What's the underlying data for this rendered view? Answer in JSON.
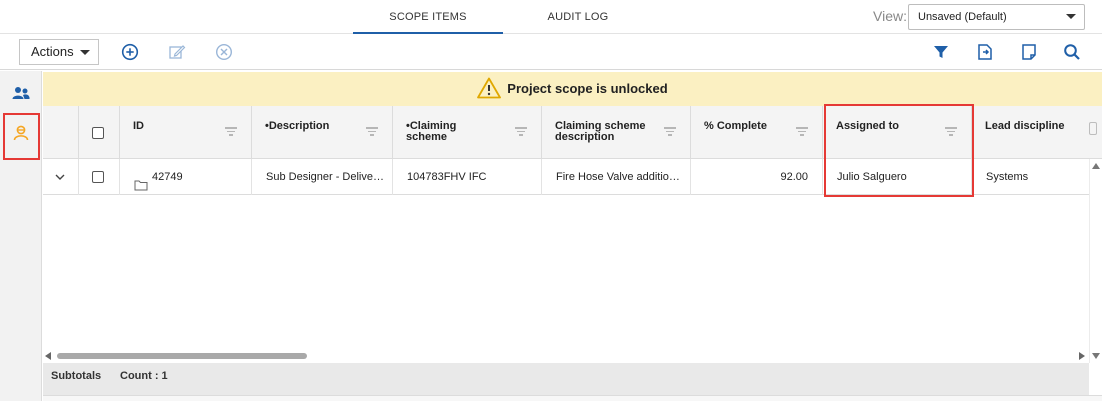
{
  "tabs": [
    {
      "label": "SCOPE ITEMS",
      "active": true
    },
    {
      "label": "AUDIT LOG",
      "active": false
    }
  ],
  "view": {
    "label": "View:",
    "selected": "Unsaved (Default)"
  },
  "toolbar": {
    "actions_label": "Actions",
    "icons": [
      "add-circle-icon",
      "edit-icon",
      "cancel-circle-icon",
      "filter-icon",
      "export-icon",
      "notes-icon",
      "search-icon"
    ]
  },
  "banner": {
    "text": "Project scope is unlocked",
    "icon": "warning-icon"
  },
  "columns": [
    {
      "label": "ID"
    },
    {
      "label": "•Description"
    },
    {
      "label_lines": [
        "•Claiming",
        "scheme"
      ]
    },
    {
      "label_lines": [
        "Claiming scheme",
        "description"
      ]
    },
    {
      "label": "% Complete"
    },
    {
      "label": "Assigned to"
    },
    {
      "label": "Lead discipline"
    }
  ],
  "rows": [
    {
      "id": "42749",
      "description": "Sub Designer - Delive…",
      "claiming_scheme": "104783FHV IFC",
      "claiming_scheme_description": "Fire Hose Valve additio…",
      "percent_complete": "92.00",
      "assigned_to": "Julio Salguero",
      "lead_discipline": "Systems"
    }
  ],
  "footer": {
    "subtotals_label": "Subtotals",
    "count_label": "Count : 1"
  },
  "colors": {
    "accent": "#1f5fa8",
    "banner_bg": "#fbf0c2",
    "highlight": "#e53935",
    "rail_active": "#f5a623"
  },
  "scroll": {
    "horizontal_thumb_fraction": 0.24
  }
}
